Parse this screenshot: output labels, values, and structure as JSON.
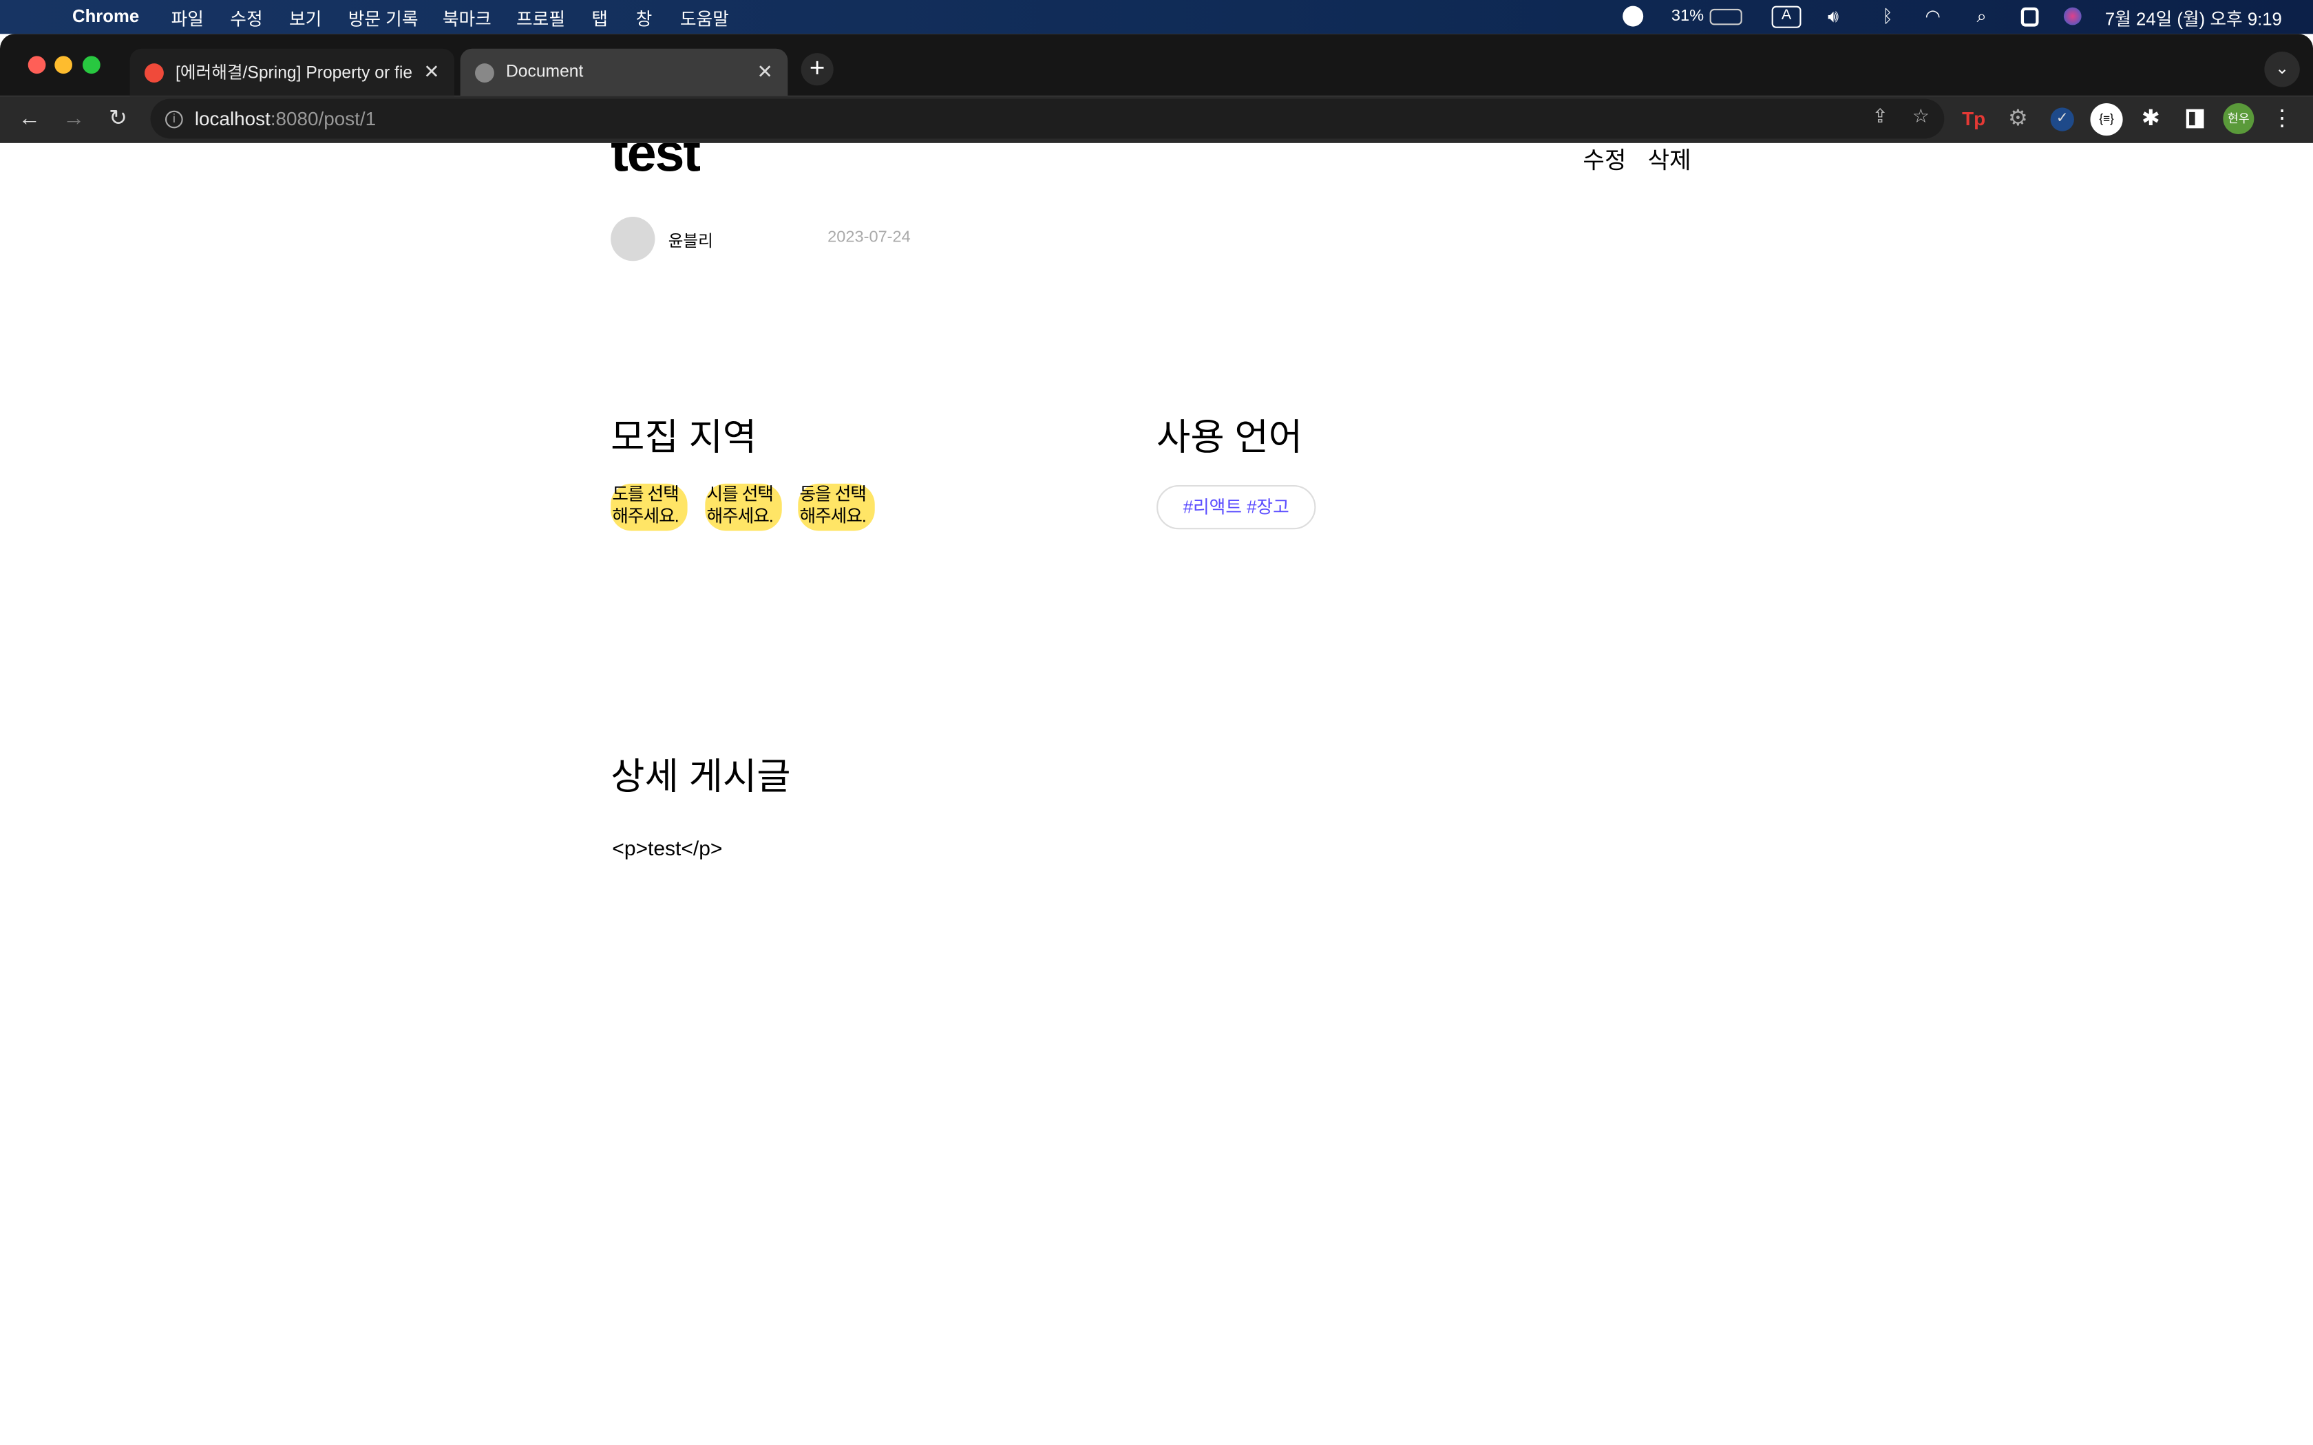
{
  "menubar": {
    "app": "Chrome",
    "items": [
      "파일",
      "수정",
      "보기",
      "방문 기록",
      "북마크",
      "프로필",
      "탭",
      "창",
      "도움말"
    ],
    "battery": "31%",
    "input": "A",
    "datetime": "7월 24일 (월) 오후 9:19"
  },
  "tabs": [
    {
      "title": "[에러해결/Spring] Property or fie"
    },
    {
      "title": "Document"
    }
  ],
  "address": {
    "host": "localhost",
    "rest": ":8080/post/1"
  },
  "profile": "현우",
  "post": {
    "title": "test",
    "edit": "수정",
    "delete": "삭제",
    "author": "윤블리",
    "date": "2023-07-24",
    "region_heading": "모집 지역",
    "regions": [
      [
        "도를 선택",
        "해주세요."
      ],
      [
        "시를 선택",
        "해주세요."
      ],
      [
        "동을 선택",
        "해주세요."
      ]
    ],
    "lang_heading": "사용 언어",
    "languages": "#리액트 #장고",
    "detail_heading": "상세 게시글",
    "body": "<p>test</p>"
  },
  "colors": {
    "highlight": "#ffe566",
    "tag_text": "#5b4dff"
  }
}
